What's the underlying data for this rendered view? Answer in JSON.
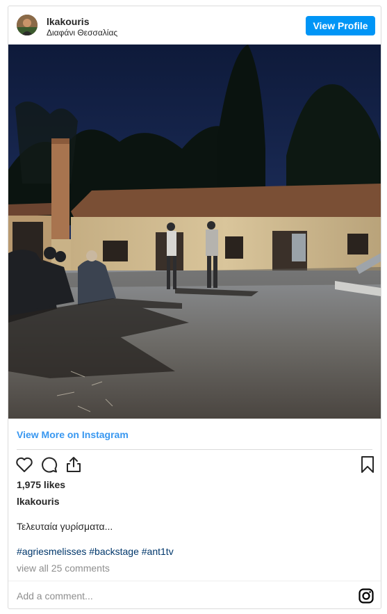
{
  "post": {
    "username": "lkakouris",
    "location": "Διαφάνι Θεσσαλίας",
    "view_profile_label": "View Profile",
    "view_more_label": "View More on Instagram",
    "likes": "1,975 likes",
    "caption_username": "lkakouris",
    "caption": "Τελευταία γυρίσματα...",
    "hashtags": [
      "#agriesmelisses",
      "#backstage",
      "#ant1tv"
    ],
    "comments_link": "view all 25 comments",
    "comment_placeholder": "Add a comment..."
  },
  "icons": {
    "like": "heart-icon",
    "comment": "comment-icon",
    "share": "share-icon",
    "save": "bookmark-icon",
    "brand": "instagram-icon"
  },
  "colors": {
    "accent": "#0095f6",
    "link": "#3897f0",
    "hashtag": "#00376b",
    "muted": "#8e8e8e",
    "border": "#dbdbdb"
  }
}
